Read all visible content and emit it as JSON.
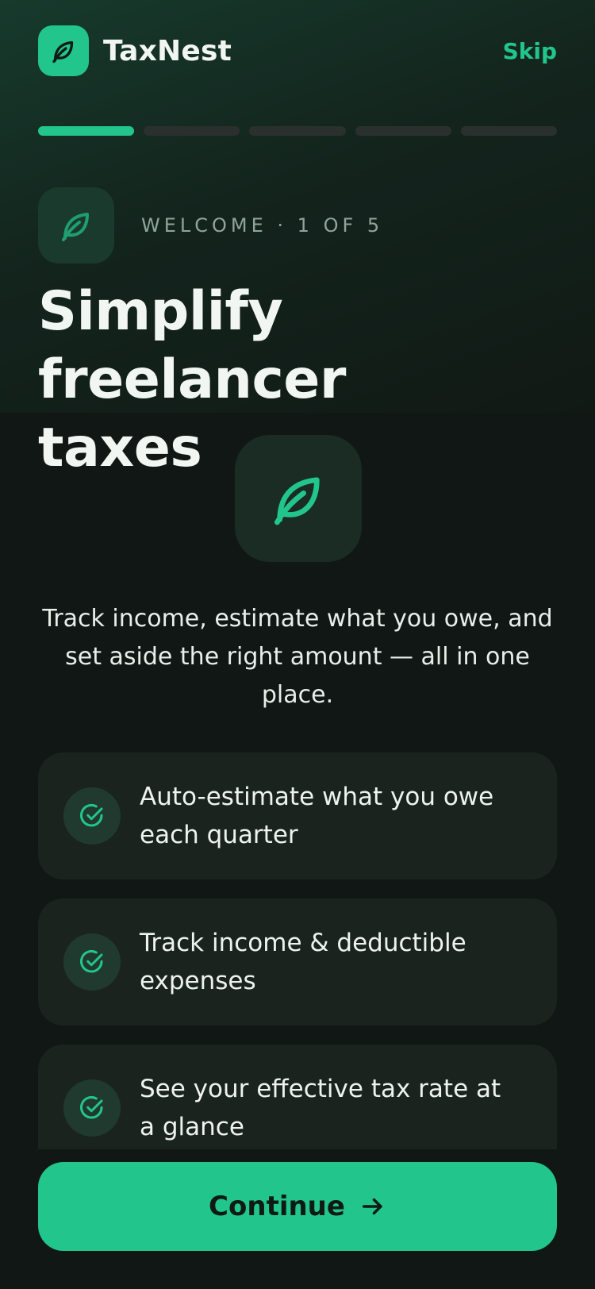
{
  "header": {
    "brand_name": "TaxNest",
    "logo_icon": "leaf-icon",
    "skip_label": "Skip"
  },
  "progress": {
    "total_steps": 5,
    "current_step": 1
  },
  "step": {
    "label": "WELCOME · 1 OF 5",
    "icon": "leaf-icon"
  },
  "title": {
    "line1": "Simplify freelancer",
    "line2": "taxes"
  },
  "description": "Track income, estimate what you owe, and set aside the right amount — all in one place.",
  "features": [
    {
      "text": "Auto-estimate what you owe each quarter",
      "icon": "check-circle-icon"
    },
    {
      "text": "Track income & deductible expenses",
      "icon": "check-circle-icon"
    },
    {
      "text": "See your effective tax rate at a glance",
      "icon": "check-circle-icon"
    }
  ],
  "cta": {
    "label": "Continue",
    "icon": "arrow-right-icon"
  },
  "colors": {
    "accent": "#22c68c",
    "background": "#111714",
    "card": "#1b231f"
  }
}
